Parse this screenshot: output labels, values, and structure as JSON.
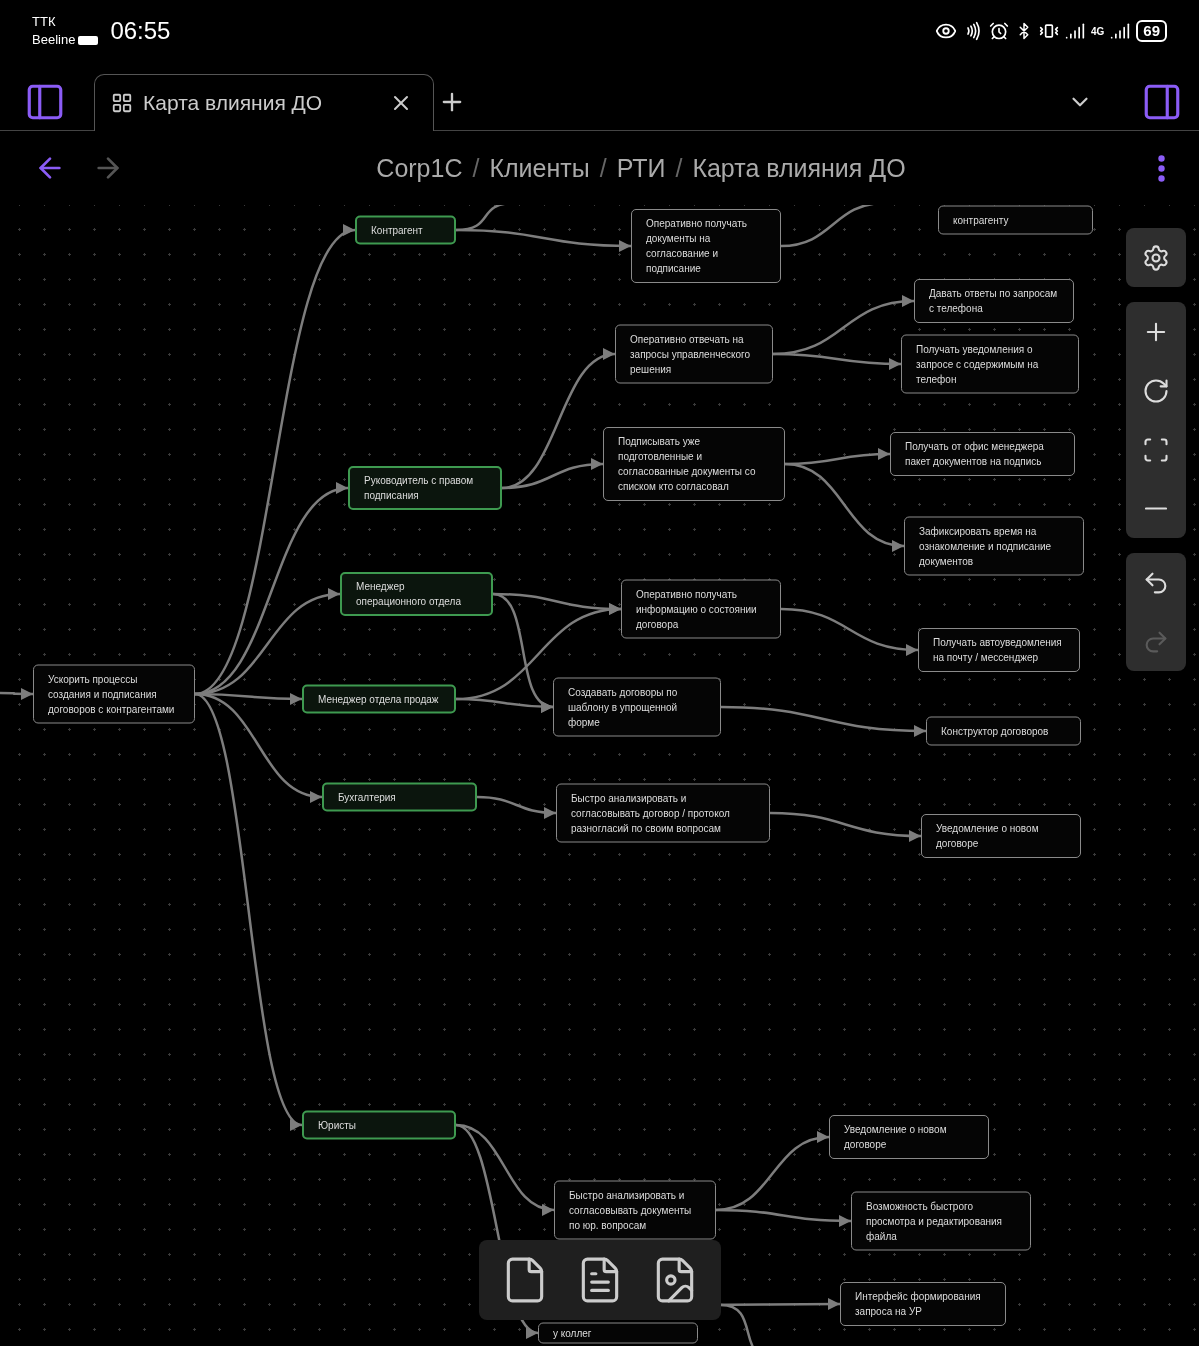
{
  "status_bar": {
    "carrier_1": "ТТК",
    "carrier_2": "Beeline",
    "time": "06:55",
    "network": "4G",
    "battery": "69"
  },
  "tabs": [
    {
      "label": "Карта влияния ДО",
      "selected": true
    }
  ],
  "navigation": {
    "back_disabled": false,
    "forward_disabled": true
  },
  "breadcrumbs": {
    "separator": "/",
    "items": [
      "Corp1C",
      "Клиенты",
      "РТИ",
      "Карта влияния ДО"
    ]
  },
  "map": {
    "nodes": [
      {
        "text": "Ускорить процессы создания и подписания договоров с контрагентами",
        "kind": "goal"
      },
      {
        "text": "Контрагент",
        "kind": "role"
      },
      {
        "text": "Руководитель с правом подписания",
        "kind": "role"
      },
      {
        "text": "Менеджер операционного отдела",
        "kind": "role"
      },
      {
        "text": "Менеджер отдела продаж",
        "kind": "role"
      },
      {
        "text": "Бухгалтерия",
        "kind": "role"
      },
      {
        "text": "Юристы",
        "kind": "role"
      },
      {
        "text": "Оперативно получать документы на согласование и подписание",
        "kind": "need"
      },
      {
        "text": "контрагенту",
        "kind": "need"
      },
      {
        "text": "Оперативно отвечать на запросы управленческого решения",
        "kind": "need"
      },
      {
        "text": "Подписывать уже подготовленные и согласованные документы со списком кто согласовал",
        "kind": "need"
      },
      {
        "text": "Давать ответы по запросам с телефона",
        "kind": "need"
      },
      {
        "text": "Получать уведомления о запросе с содержимым на телефон",
        "kind": "need"
      },
      {
        "text": "Получать от офис менеджера пакет документов на подпись",
        "kind": "need"
      },
      {
        "text": "Зафиксировать время на ознакомление и подписание документов",
        "kind": "need"
      },
      {
        "text": "Оперативно получать информацию о состоянии договора",
        "kind": "need"
      },
      {
        "text": "Создавать договоры по шаблону в упрощенной форме",
        "kind": "need"
      },
      {
        "text": "Получать автоуведомления на почту / мессенджер",
        "kind": "need"
      },
      {
        "text": "Конструктор договоров",
        "kind": "need"
      },
      {
        "text": "Быстро анализировать и согласовывать договор / протокол разногласий по своим вопросам",
        "kind": "need"
      },
      {
        "text": "Уведомление о новом договоре",
        "kind": "need"
      },
      {
        "text": "Быстро анализировать и согласовывать документы по юр. вопросам",
        "kind": "need"
      },
      {
        "text": "Уведомление о новом договоре",
        "kind": "need"
      },
      {
        "text": "Возможность быстрого просмотра и редактирования файла",
        "kind": "need"
      },
      {
        "text": "Интерфейс формирования запроса на УР",
        "kind": "need"
      },
      {
        "text": "у коллег",
        "kind": "need"
      }
    ]
  },
  "map_tools": [
    [
      {
        "kind": "settings",
        "disabled": false
      }
    ],
    [
      {
        "kind": "zoom_in",
        "disabled": false
      },
      {
        "kind": "reset",
        "disabled": false
      },
      {
        "kind": "fit",
        "disabled": false
      },
      {
        "kind": "zoom_out",
        "disabled": false
      }
    ],
    [
      {
        "kind": "undo",
        "disabled": false
      },
      {
        "kind": "redo",
        "disabled": true
      }
    ]
  ],
  "file_toolbar": [
    {
      "kind": "blank"
    },
    {
      "kind": "text"
    },
    {
      "kind": "image"
    }
  ]
}
